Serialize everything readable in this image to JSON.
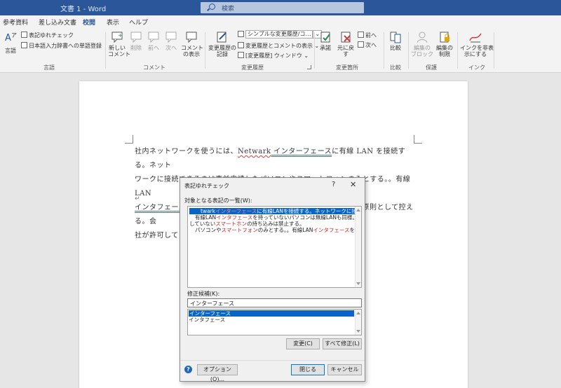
{
  "titlebar": {
    "title": "文書 1  -  Word",
    "search_placeholder": "検索"
  },
  "tabs": [
    {
      "label": "参考資料",
      "active": false
    },
    {
      "label": "差し込み文書",
      "active": false
    },
    {
      "label": "校閲",
      "active": true
    },
    {
      "label": "表示",
      "active": false
    },
    {
      "label": "ヘルプ",
      "active": false
    }
  ],
  "ribbon": {
    "groups": {
      "language": "言語",
      "comments": "コメント",
      "tracking": "変更履歴",
      "changes": "変更箇所",
      "compare": "比較",
      "protect": "保護",
      "ink": "インク"
    },
    "buttons": {
      "language": "言語",
      "notation_check": "表記ゆれチェック",
      "dictionary": "日本語入力辞書への単語登録",
      "new_comment": "新しい\nコメント",
      "delete": "削除",
      "previous": "前へ",
      "next": "次へ",
      "show_comments": "コメント\nの表示",
      "track_changes": "変更履歴の\n記録",
      "markup_select": "シンプルな変更履歴/コ…",
      "show_markup": "変更履歴とコメントの表示",
      "reviewing_pane": "[変更履歴] ウィンドウ",
      "accept": "承諾",
      "reject": "元に戻す",
      "change_prev": "前へ",
      "change_next": "次へ",
      "compare": "比較",
      "block_authors": "編集の\nブロック",
      "restrict_editing": "編集の\n制限",
      "hide_ink": "インクを非表\n示にする"
    }
  },
  "document": {
    "line1_a": "社内ネットワークを使うには、",
    "line1_err": "Netwark",
    "line1_b": " インターフェース",
    "line1_c": "に有線 LAN を接続する。ネット",
    "line2": "ワークに接続できるのは事前申請したパソコンやスマートフォンのみとする。。有線 LAN",
    "line3_a": "インタフェースを持っていないパソコン",
    "line3_b": "は無線 LAN も同様。接続は原則として控える。会",
    "line4": "社が許可してい",
    "para_mark": "↵"
  },
  "dialog": {
    "title": "表記ゆれチェック",
    "help": "?",
    "close": "✕",
    "list_label": "対象となる表記の一覧(W):",
    "list_lines": [
      "twarkインターフェースに有線LANを接続する。ネットワークに接続できるの",
      "有線LANインタフェースを持っていないパソコンは無線LANも同様。接続は原",
      "していないスマートホンの持ち込みは禁止する。",
      "パソコンやスマートフォンのみとする。。有線LANインタフェースを持っていないパ"
    ],
    "suggest_label": "修正候補(K):",
    "suggest_value": "インターフェース",
    "suggestions": [
      "インターフェース",
      "インタフェース"
    ],
    "change_btn": "変更(C)",
    "change_all_btn": "すべて修正(L)",
    "options_btn": "オプション(O)...",
    "close_btn": "閉じる",
    "cancel_btn": "キャンセル"
  }
}
